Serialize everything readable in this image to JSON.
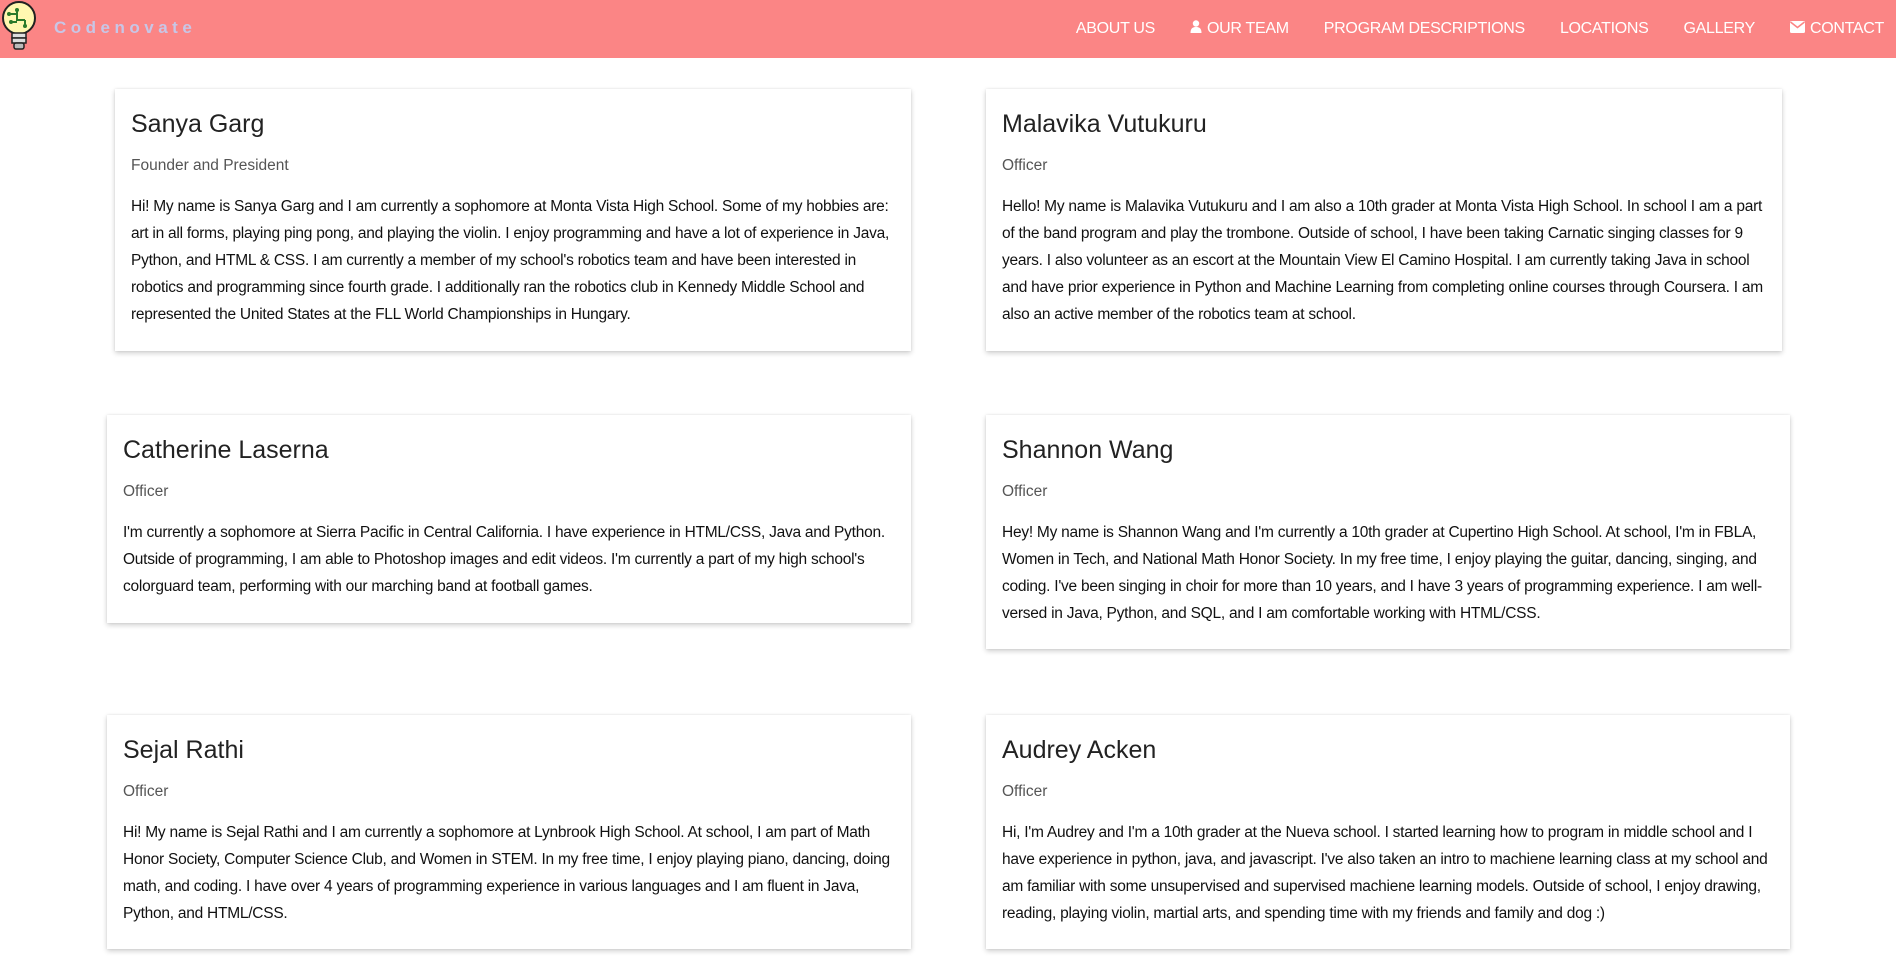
{
  "brand": {
    "name": "Codenovate",
    "logo_icon": "lightbulb-circuit-icon",
    "text_color": "#c8c6e6"
  },
  "colors": {
    "navbar_bg": "#fb8585",
    "nav_text": "#ffffff",
    "page_bg": "#ffffff"
  },
  "nav": {
    "items": [
      {
        "label": "ABOUT US",
        "icon": ""
      },
      {
        "label": "OUR TEAM",
        "icon": "user-icon"
      },
      {
        "label": "PROGRAM DESCRIPTIONS",
        "icon": ""
      },
      {
        "label": "LOCATIONS",
        "icon": ""
      },
      {
        "label": "GALLERY",
        "icon": ""
      },
      {
        "label": "CONTACT",
        "icon": "envelope-icon"
      }
    ]
  },
  "team": [
    {
      "name": "Sanya Garg",
      "role": "Founder and President",
      "bio": "Hi! My name is Sanya Garg and I am currently a sophomore at Monta Vista High School. Some of my hobbies are: art in all forms, playing ping pong, and playing the violin. I enjoy programming and have a lot of experience in Java, Python, and HTML & CSS. I am currently a member of my school's robotics team and have been interested in robotics and programming since fourth grade. I additionally ran the robotics club in Kennedy Middle School and represented the United States at the FLL World Championships in Hungary."
    },
    {
      "name": "Malavika Vutukuru",
      "role": "Officer",
      "bio": "Hello! My name is Malavika Vutukuru and I am also a 10th grader at Monta Vista High School. In school I am a part of the band program and play the trombone. Outside of school, I have been taking Carnatic singing classes for 9 years. I also volunteer as an escort at the Mountain View El Camino Hospital. I am currently taking Java in school and have prior experience in Python and Machine Learning from completing online courses through Coursera. I am also an active member of the robotics team at school."
    },
    {
      "name": "Catherine Laserna",
      "role": "Officer",
      "bio": "I'm currently a sophomore at Sierra Pacific in Central California. I have experience in HTML/CSS, Java and Python. Outside of programming, I am able to Photoshop images and edit videos. I'm currently a part of my high school's colorguard team, performing with our marching band at football games."
    },
    {
      "name": "Shannon Wang",
      "role": "Officer",
      "bio": "Hey! My name is Shannon Wang and I'm currently a 10th grader at Cupertino High School. At school, I'm in FBLA, Women in Tech, and National Math Honor Society. In my free time, I enjoy playing the guitar, dancing, singing, and coding. I've been singing in choir for more than 10 years, and I have 3 years of programming experience. I am well-versed in Java, Python, and SQL, and I am comfortable working with HTML/CSS."
    },
    {
      "name": "Sejal Rathi",
      "role": "Officer",
      "bio": "Hi! My name is Sejal Rathi and I am currently a sophomore at Lynbrook High School. At school, I am part of Math Honor Society, Computer Science Club, and Women in STEM. In my free time, I enjoy playing piano, dancing, doing math, and coding. I have over 4 years of programming experience in various languages and I am fluent in Java, Python, and HTML/CSS."
    },
    {
      "name": "Audrey Acken",
      "role": "Officer",
      "bio": "Hi, I'm Audrey and I'm a 10th grader at the Nueva school. I started learning how to program in middle school and I have experience in python, java, and javascript. I've also taken an intro to machiene learning class at my school and am familiar with some unsupervised and supervised machiene learning models. Outside of school, I enjoy drawing, reading, playing violin, martial arts, and spending time with my friends and family and dog :)"
    }
  ]
}
